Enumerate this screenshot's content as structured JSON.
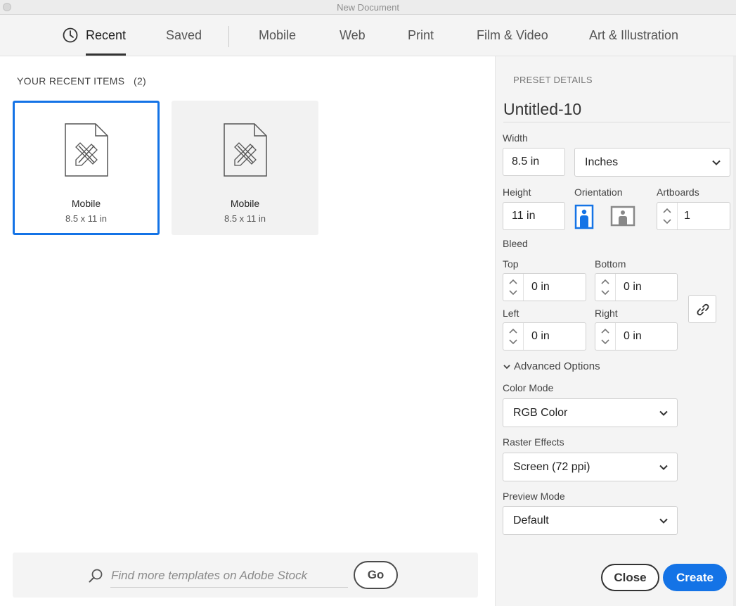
{
  "window": {
    "title": "New Document"
  },
  "tabs": [
    {
      "label": "Recent",
      "active": true
    },
    {
      "label": "Saved"
    },
    {
      "label": "Mobile"
    },
    {
      "label": "Web"
    },
    {
      "label": "Print"
    },
    {
      "label": "Film & Video"
    },
    {
      "label": "Art & Illustration"
    }
  ],
  "recent": {
    "title": "YOUR RECENT ITEMS",
    "count": "(2)",
    "items": [
      {
        "name": "Mobile",
        "size": "8.5 x 11 in",
        "selected": true
      },
      {
        "name": "Mobile",
        "size": "8.5 x 11 in",
        "selected": false
      }
    ]
  },
  "stock": {
    "placeholder": "Find more templates on Adobe Stock",
    "go_label": "Go"
  },
  "preset": {
    "header": "PRESET DETAILS",
    "name": "Untitled-10",
    "width_label": "Width",
    "width_value": "8.5 in",
    "units": "Inches",
    "height_label": "Height",
    "height_value": "11 in",
    "orientation_label": "Orientation",
    "orientation": "portrait",
    "artboards_label": "Artboards",
    "artboards_value": "1",
    "bleed_label": "Bleed",
    "bleed_top_label": "Top",
    "bleed_top": "0 in",
    "bleed_bottom_label": "Bottom",
    "bleed_bottom": "0 in",
    "bleed_left_label": "Left",
    "bleed_left": "0 in",
    "bleed_right_label": "Right",
    "bleed_right": "0 in",
    "advanced_label": "Advanced Options",
    "color_mode_label": "Color Mode",
    "color_mode": "RGB Color",
    "raster_label": "Raster Effects",
    "raster": "Screen (72 ppi)",
    "preview_label": "Preview Mode",
    "preview": "Default"
  },
  "actions": {
    "close": "Close",
    "create": "Create"
  },
  "colors": {
    "accent": "#1473e6",
    "text": "#333333",
    "panel": "#f4f4f4"
  }
}
